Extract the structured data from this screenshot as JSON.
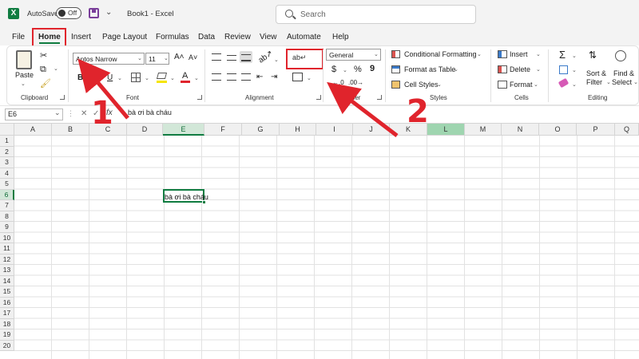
{
  "titlebar": {
    "autosave_label": "AutoSave",
    "autosave_state": "Off",
    "doc_title": "Book1  -  Excel",
    "search_placeholder": "Search"
  },
  "menu_tabs": [
    "File",
    "Home",
    "Insert",
    "Page Layout",
    "Formulas",
    "Data",
    "Review",
    "View",
    "Automate",
    "Help"
  ],
  "active_tab": "Home",
  "ribbon": {
    "clipboard": {
      "paste": "Paste",
      "group": "Clipboard"
    },
    "font": {
      "name": "Aptos Narrow",
      "size": "11",
      "bold": "B",
      "italic": "I",
      "underline": "U",
      "group": "Font"
    },
    "alignment": {
      "group": "Alignment"
    },
    "number": {
      "format": "General",
      "currency": "$",
      "percent": "%",
      "comma": "9",
      "group": "Number"
    },
    "styles": {
      "conditional": "Conditional Formatting",
      "format_table": "Format as Table",
      "cell_styles": "Cell Styles",
      "group": "Styles"
    },
    "cells": {
      "insert": "Insert",
      "delete": "Delete",
      "format": "Format",
      "group": "Cells"
    },
    "editing": {
      "sort1": "Sort &",
      "sort2": "Filter",
      "find1": "Find &",
      "find2": "Select",
      "group": "Editing"
    }
  },
  "formula_bar": {
    "name_box": "E6",
    "fx": "fx",
    "content": "bà ơi bà cháu"
  },
  "grid": {
    "columns": [
      "A",
      "B",
      "C",
      "D",
      "E",
      "F",
      "G",
      "H",
      "I",
      "J",
      "K",
      "L",
      "M",
      "N",
      "O",
      "P",
      "Q"
    ],
    "rows": [
      "1",
      "2",
      "3",
      "4",
      "5",
      "6",
      "7",
      "8",
      "9",
      "10",
      "11",
      "12",
      "13",
      "14",
      "15",
      "16",
      "17",
      "18",
      "19",
      "20"
    ],
    "selected_cell": {
      "col": "E",
      "row": "6",
      "value": "bà ơi bà cháu"
    }
  },
  "annotations": {
    "step1": "1",
    "step2": "2",
    "color": "#e0242c"
  },
  "colors": {
    "accent": "#107c41",
    "annotation": "#e0242c"
  }
}
